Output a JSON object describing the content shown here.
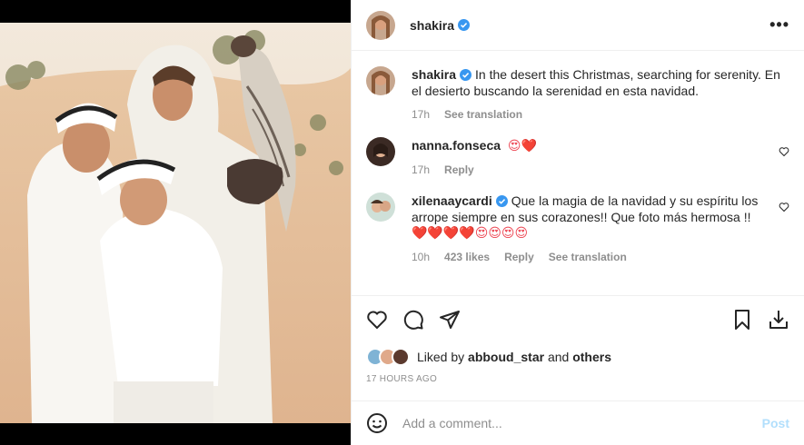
{
  "header": {
    "username": "shakira",
    "more_label": "•••"
  },
  "caption": {
    "username": "shakira",
    "text": "In the desert this Christmas, searching for serenity. En el desierto buscando la serenidad en esta navidad.",
    "time": "17h",
    "translate": "See translation"
  },
  "comments": [
    {
      "username": "nanna.fonseca",
      "emojis": "😍❤️",
      "time": "17h",
      "reply": "Reply"
    },
    {
      "username": "xilenaaycardi",
      "text": "Que la magia de la navidad y su espíritu los arrope siempre en sus corazones!! Que foto más hermosa !!",
      "emojis": "❤️❤️❤️❤️😍😍😍😍",
      "time": "10h",
      "likes": "423 likes",
      "reply": "Reply",
      "translate": "See translation"
    }
  ],
  "likes": {
    "prefix": "Liked by ",
    "user": "abboud_star",
    "mid": " and ",
    "others": "others"
  },
  "posted_ago": "17 HOURS AGO",
  "add_comment": {
    "placeholder": "Add a comment...",
    "post_label": "Post"
  },
  "colors": {
    "verified": "#3897f0",
    "post_disabled": "#b2dffc",
    "like_red": "#ed4956"
  }
}
